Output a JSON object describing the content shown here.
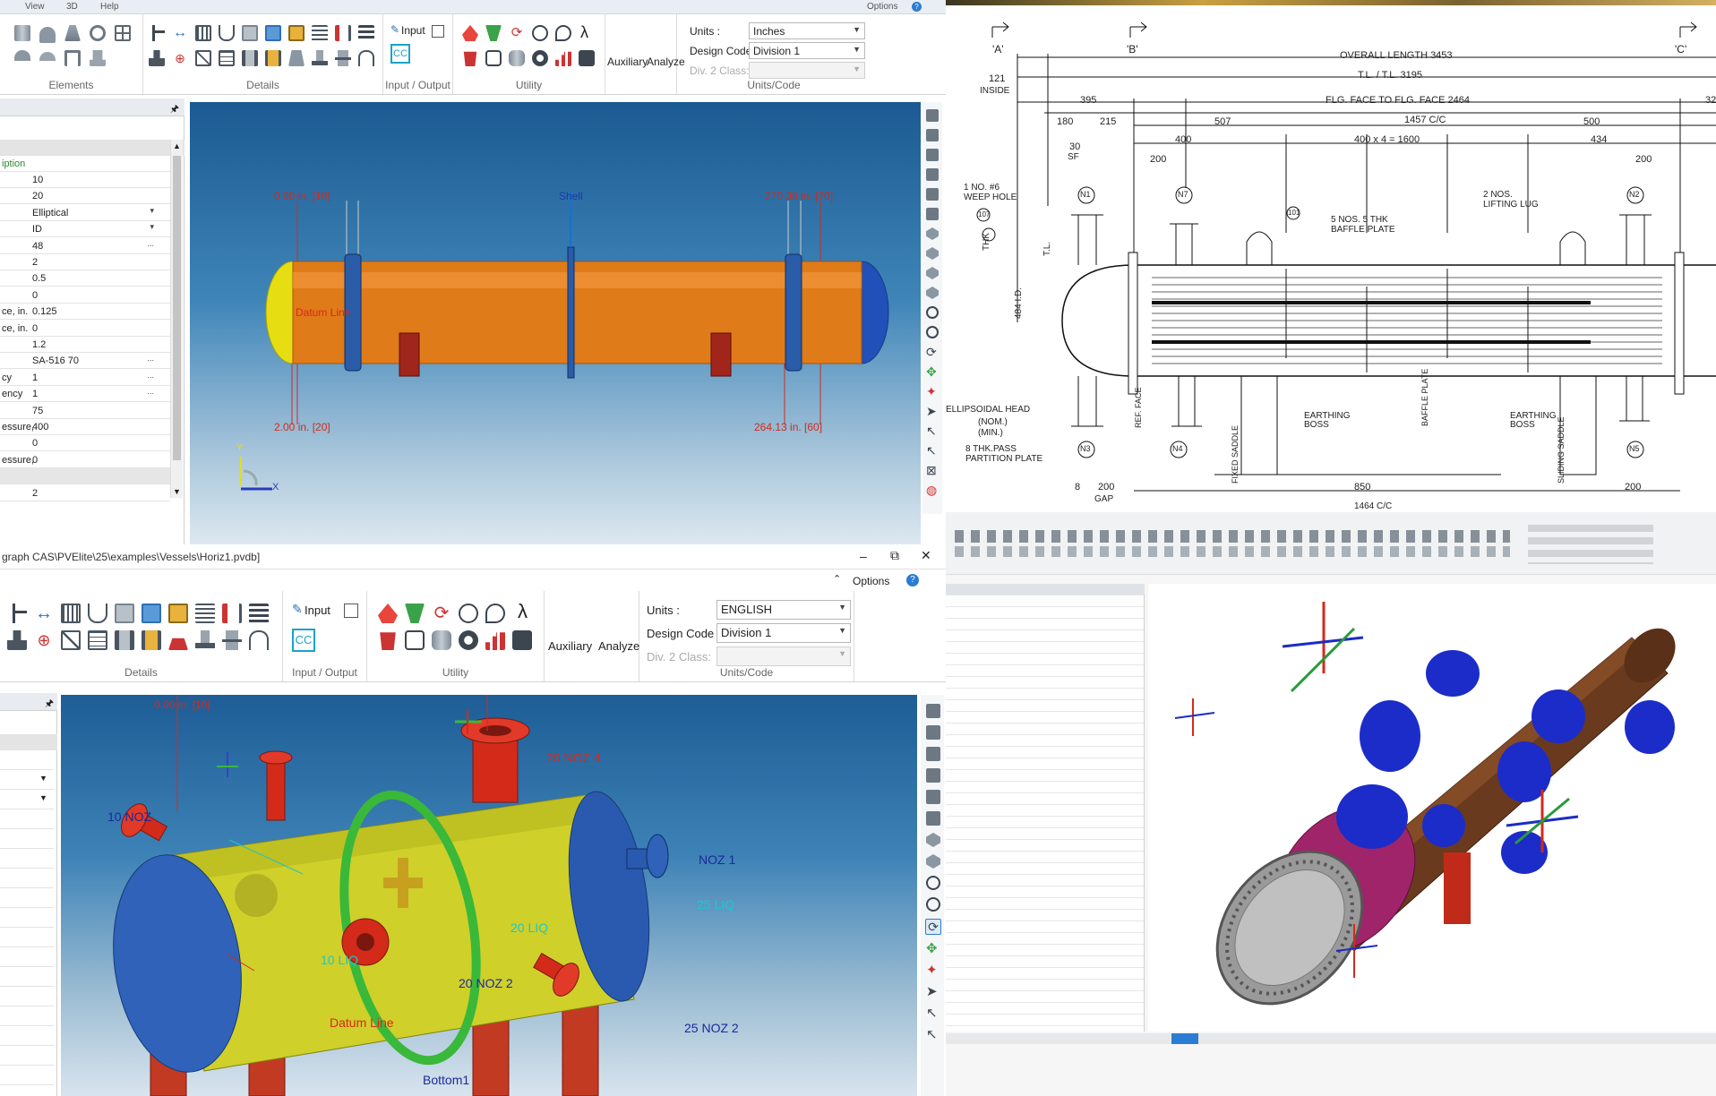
{
  "top_window": {
    "menu": {
      "view": "View",
      "three_d": "3D",
      "help": "Help",
      "options": "Options"
    },
    "groups": {
      "elements": "Elements",
      "details": "Details",
      "io": "Input / Output",
      "utility": "Utility",
      "units_code": "Units/Code"
    },
    "input_label": "Input",
    "cc_label": "CC",
    "lambda": "λ",
    "auxiliary": "Auxiliary",
    "analyze": "Analyze",
    "units_label": "Units :",
    "units_value": "Inches",
    "design_code_label": "Design Code :",
    "design_code_value": "Division 1",
    "div2_label": "Div. 2 Class:",
    "pin": "🖈",
    "grid_header": "iption",
    "grid_rows": [
      {
        "k": "",
        "v": "10"
      },
      {
        "k": "",
        "v": "20"
      },
      {
        "k": "",
        "v": "Elliptical",
        "dd": "▾"
      },
      {
        "k": "",
        "v": "ID",
        "dd": "▾"
      },
      {
        "k": "",
        "v": "48",
        "dd": "..."
      },
      {
        "k": "",
        "v": "2"
      },
      {
        "k": "",
        "v": "0.5"
      },
      {
        "k": "",
        "v": "0"
      },
      {
        "k": "ce, in.",
        "v": "0.125"
      },
      {
        "k": "ce, in.",
        "v": "0"
      },
      {
        "k": "",
        "v": "1.2"
      },
      {
        "k": "",
        "v": "SA-516 70",
        "dd": "..."
      },
      {
        "k": "cy",
        "v": "1",
        "dd": "..."
      },
      {
        "k": "ency",
        "v": "1",
        "dd": "..."
      },
      {
        "k": "",
        "v": "75"
      },
      {
        "k": "essure,",
        "v": "400"
      },
      {
        "k": "",
        "v": "0"
      },
      {
        "k": "essure,",
        "v": "0"
      },
      {
        "k": "",
        "v": ""
      },
      {
        "k": "",
        "v": "2"
      }
    ],
    "viewport": {
      "label_tl": "0.00 in.  [10]",
      "label_shell": "Shell",
      "label_tr": "270.38 in.  [70]",
      "label_datum": "Datum Line",
      "label_bl": "2.00 in.  [20]",
      "label_br": "264.13 in.  [60]",
      "axis_y": "Y",
      "axis_x": "X"
    }
  },
  "drawing": {
    "sections": [
      "'A'",
      "'B'",
      "'C'"
    ],
    "overall_length": "OVERALL LENGTH  3453",
    "tl_tl": "T.L. / T.L.  3195",
    "flg_face": "FLG. FACE  TO  FLG. FACE  2464",
    "cc_1457": "1457 C/C",
    "dims": [
      "121",
      "395",
      "180",
      "215",
      "507",
      "400",
      "400 x 4 = 1600",
      "434",
      "500",
      "200",
      "200",
      "30",
      "32",
      "200",
      "850",
      "200",
      "8",
      "200"
    ],
    "inside": "INSIDE",
    "sf": "SF",
    "weep_hole": "1 NO. #6\nWEEP HOLE",
    "baffle": "5 NOS. 5 THK\nBAFFLE PLATE",
    "lifting": "2 NOS.\nLIFTING LUG",
    "ellip_head": "ELLIPSOIDAL HEAD",
    "nom": "(NOM.)",
    "min": "(MIN.)",
    "partition": "8 THK.PASS\nPARTITION PLATE",
    "earthing1": "EARTHING\nBOSS",
    "earthing2": "EARTHING\nBOSS",
    "gap": "GAP",
    "nozzles": [
      "N1",
      "N7",
      "N3",
      "N2",
      "N4",
      "N5"
    ],
    "ref_face": "REF. FACE",
    "fixed_saddle": "FIXED SADDLE",
    "baffle_plate": "BAFFLE PLATE",
    "sliding_saddle": "SLIDING SADDLE",
    "thk": "THK",
    "id_484": "484 I.D.",
    "ellip_label": "T.L.",
    "bottom_cc": "1464 C/C",
    "small_nums": [
      "107",
      "101",
      "106",
      "100"
    ]
  },
  "bottom_window": {
    "path": "graph CAS\\PVElite\\25\\examples\\Vessels\\Horiz1.pvdb]",
    "win_min": "–",
    "win_max": "⧉",
    "win_close": "✕",
    "options": "Options",
    "collapse": "⌃",
    "groups": {
      "details": "Details",
      "io": "Input / Output",
      "utility": "Utility",
      "units_code": "Units/Code"
    },
    "input_label": "Input",
    "cc_label": "CC",
    "lambda": "λ",
    "auxiliary": "Auxiliary",
    "analyze": "Analyze",
    "units_label": "Units :",
    "units_value": "ENGLISH",
    "design_code_label": "Design Code :",
    "design_code_value": "Division 1",
    "div2_label": "Div. 2 Class:",
    "pin": "🖈",
    "viewport": {
      "top_label": "0.00 in.  [10]",
      "noz4": "20 NOZ 4",
      "noz_10": "10 NOZ",
      "noz1": "NOZ 1",
      "liq25": "25 LIQ",
      "liq20": "20 LIQ",
      "liq10": "10 LIQ",
      "noz2a": "20 NOZ 2",
      "noz2b": "25 NOZ 2",
      "datum": "Datum Line",
      "bottom": "Bottom1"
    }
  },
  "colors": {
    "shell_orange": "#e07b1a",
    "head_yellow": "#e6de12",
    "head_blue": "#2050b8",
    "red": "#d42a1a",
    "viewport_top": "#1f5f98",
    "viewport_bottom": "#d8e4ee",
    "accent": "#2b7cd3"
  }
}
